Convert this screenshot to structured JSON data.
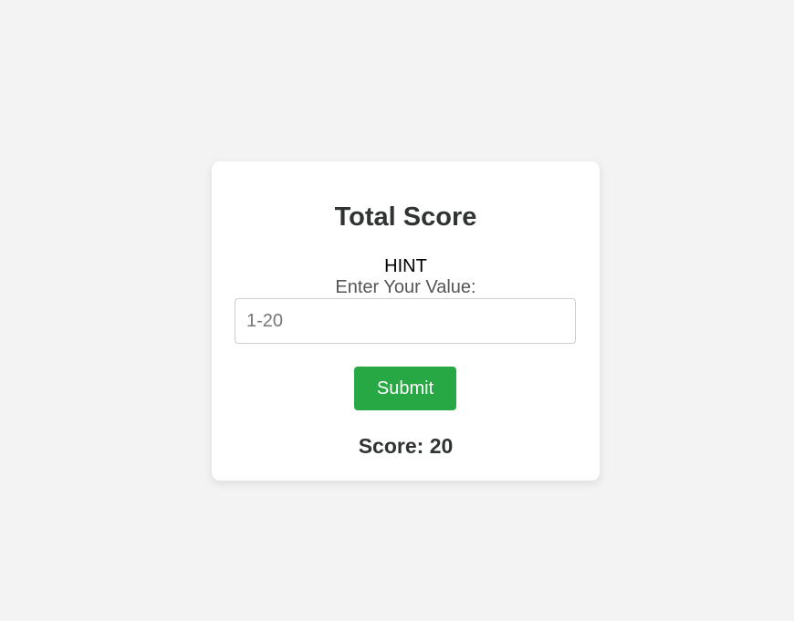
{
  "card": {
    "title": "Total Score",
    "hint": "HINT",
    "input_label": "Enter Your Value:",
    "input_placeholder": "1-20",
    "input_value": "",
    "submit_label": "Submit",
    "score_text": "Score: 20"
  },
  "colors": {
    "page_background": "#f3f3f3",
    "card_background": "#ffffff",
    "button_background": "#28a745",
    "button_text": "#ffffff",
    "title_text": "#2f3332"
  }
}
